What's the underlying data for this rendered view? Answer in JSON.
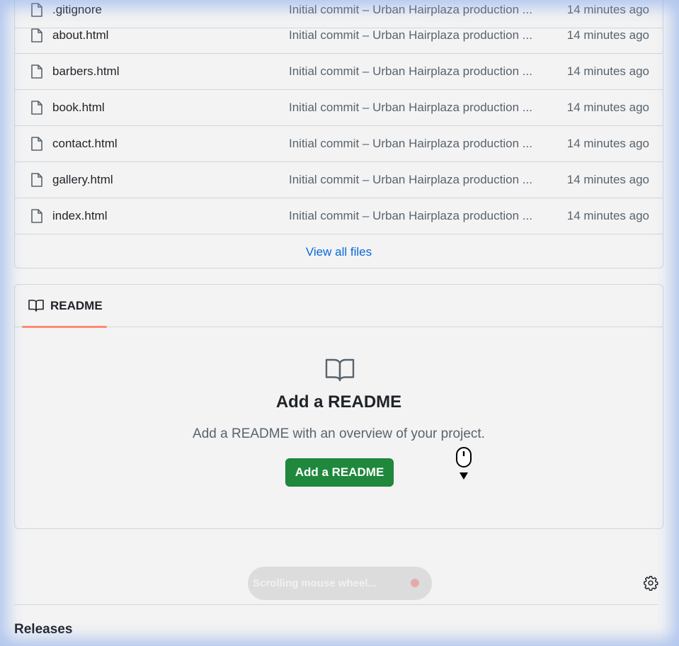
{
  "files": [
    {
      "name": ".gitignore",
      "commit": "Initial commit – Urban Hairplaza production ...",
      "time": "14 minutes ago"
    },
    {
      "name": "about.html",
      "commit": "Initial commit – Urban Hairplaza production ...",
      "time": "14 minutes ago"
    },
    {
      "name": "barbers.html",
      "commit": "Initial commit – Urban Hairplaza production ...",
      "time": "14 minutes ago"
    },
    {
      "name": "book.html",
      "commit": "Initial commit – Urban Hairplaza production ...",
      "time": "14 minutes ago"
    },
    {
      "name": "contact.html",
      "commit": "Initial commit – Urban Hairplaza production ...",
      "time": "14 minutes ago"
    },
    {
      "name": "gallery.html",
      "commit": "Initial commit – Urban Hairplaza production ...",
      "time": "14 minutes ago"
    },
    {
      "name": "index.html",
      "commit": "Initial commit – Urban Hairplaza production ...",
      "time": "14 minutes ago"
    }
  ],
  "view_all_label": "View all files",
  "readme": {
    "tab_label": "README",
    "heading": "Add a README",
    "description": "Add a README with an overview of your project.",
    "button_label": "Add a README"
  },
  "toast": {
    "text": "Scrolling mouse wheel..."
  },
  "releases": {
    "title": "Releases"
  },
  "icons": {
    "file": "file-icon",
    "book": "book-icon",
    "gear": "gear-icon",
    "mouse": "mouse-scroll-icon"
  },
  "colors": {
    "link": "#0969da",
    "button_green": "#1f883d",
    "tab_underline": "#fd8c73",
    "muted_text": "#59636e"
  }
}
